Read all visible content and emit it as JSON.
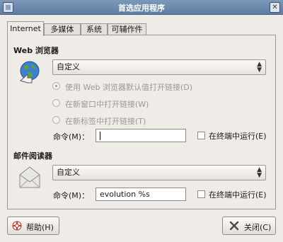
{
  "window": {
    "title": "首选应用程序",
    "close_glyph": "✕"
  },
  "tabs": [
    "Internet",
    "多媒体",
    "系统",
    "可辅作件"
  ],
  "web_browser": {
    "section_title": "Web 浏览器",
    "icon": "globe-arrow-icon",
    "selected": "自定义",
    "radio_options": [
      "使用 Web 浏览器默认值打开链接(D)",
      "在新窗口中打开链接(W)",
      "在新标签中打开链接(T)"
    ],
    "command_label": "命令(M)：",
    "command_value": "",
    "terminal_label": "在终端中运行(E)",
    "terminal_checked": false
  },
  "mail_reader": {
    "section_title": "邮件阅读器",
    "icon": "mail-envelope-icon",
    "selected": "自定义",
    "command_label": "命令(M)：",
    "command_value": "evolution %s",
    "terminal_label": "在终端中运行(E)",
    "terminal_checked": false
  },
  "buttons": {
    "help": "帮助(H)",
    "close": "关闭(C)"
  },
  "colors": {
    "titlebar": "#6f8bb0",
    "dialog_bg": "#efebe7",
    "disabled_text": "#9c9891"
  }
}
